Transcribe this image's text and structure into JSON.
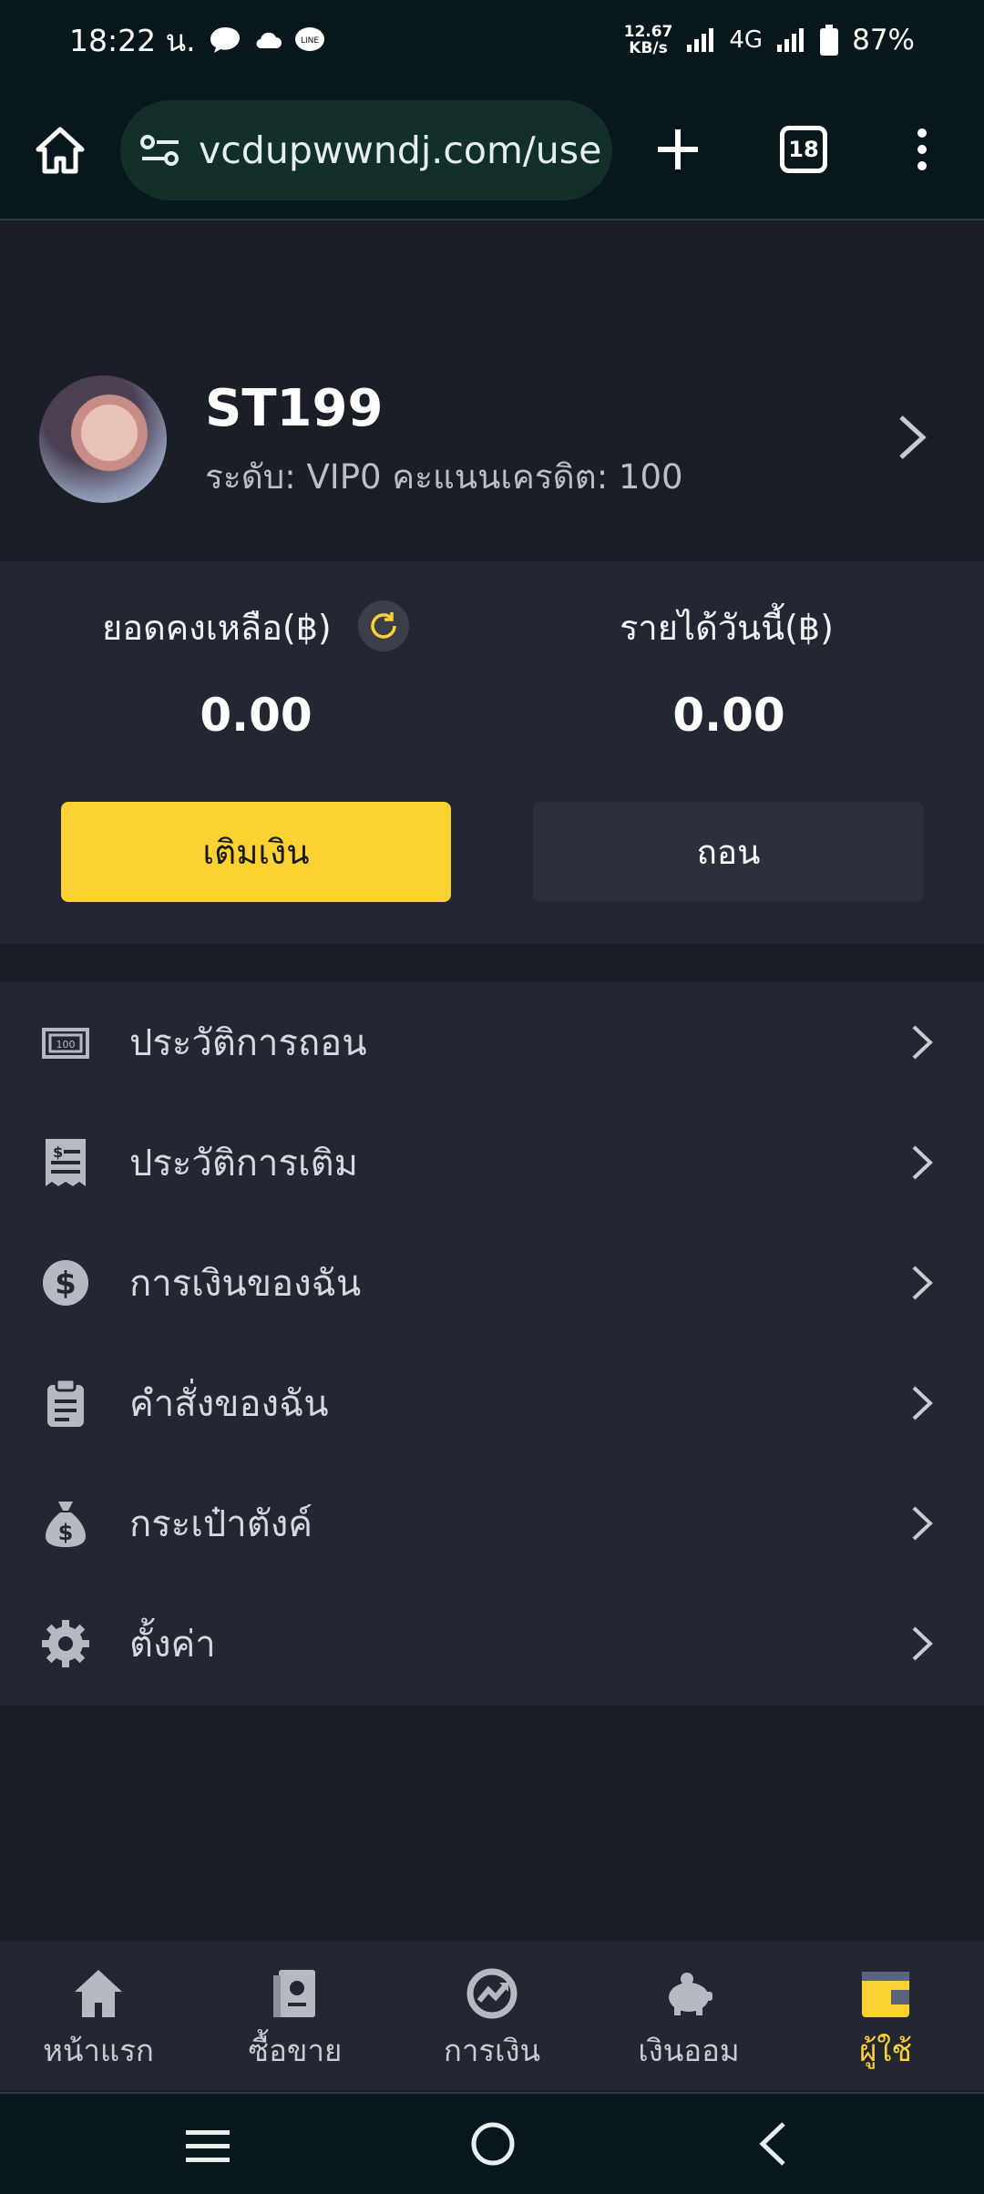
{
  "status_bar": {
    "time": "18:22 น.",
    "net_speed_value": "12.67",
    "net_speed_unit": "KB/s",
    "network": "4G",
    "battery": "87%"
  },
  "browser": {
    "url": "vcdupwwndj.com/use",
    "tab_count": "18"
  },
  "profile": {
    "username": "ST199",
    "level_line": "ระดับ: VIP0  คะแนนเครดิต: 100"
  },
  "balance": {
    "balance_label": "ยอดคงเหลือ(฿)",
    "balance_value": "0.00",
    "income_label": "รายได้วันนี้(฿)",
    "income_value": "0.00",
    "deposit_label": "เติมเงิน",
    "withdraw_label": "ถอน"
  },
  "menu": {
    "items": [
      {
        "label": "ประวัติการถอน",
        "icon": "cash-icon"
      },
      {
        "label": "ประวัติการเติม",
        "icon": "receipt-icon"
      },
      {
        "label": "การเงินของฉัน",
        "icon": "dollar-icon"
      },
      {
        "label": "คำสั่งของฉัน",
        "icon": "clipboard-icon"
      },
      {
        "label": "กระเป๋าตังค์",
        "icon": "money-bag-icon"
      },
      {
        "label": "ตั้งค่า",
        "icon": "gear-icon"
      }
    ]
  },
  "tabs": [
    {
      "label": "หน้าแรก",
      "icon": "home-icon"
    },
    {
      "label": "ซื้อขาย",
      "icon": "passport-icon"
    },
    {
      "label": "การเงิน",
      "icon": "exchange-icon"
    },
    {
      "label": "เงินออม",
      "icon": "piggy-bank-icon"
    },
    {
      "label": "ผู้ใช้",
      "icon": "wallet-icon"
    }
  ],
  "colors": {
    "accent": "#fbd231",
    "panel": "#222731",
    "background": "#1a1e26"
  }
}
